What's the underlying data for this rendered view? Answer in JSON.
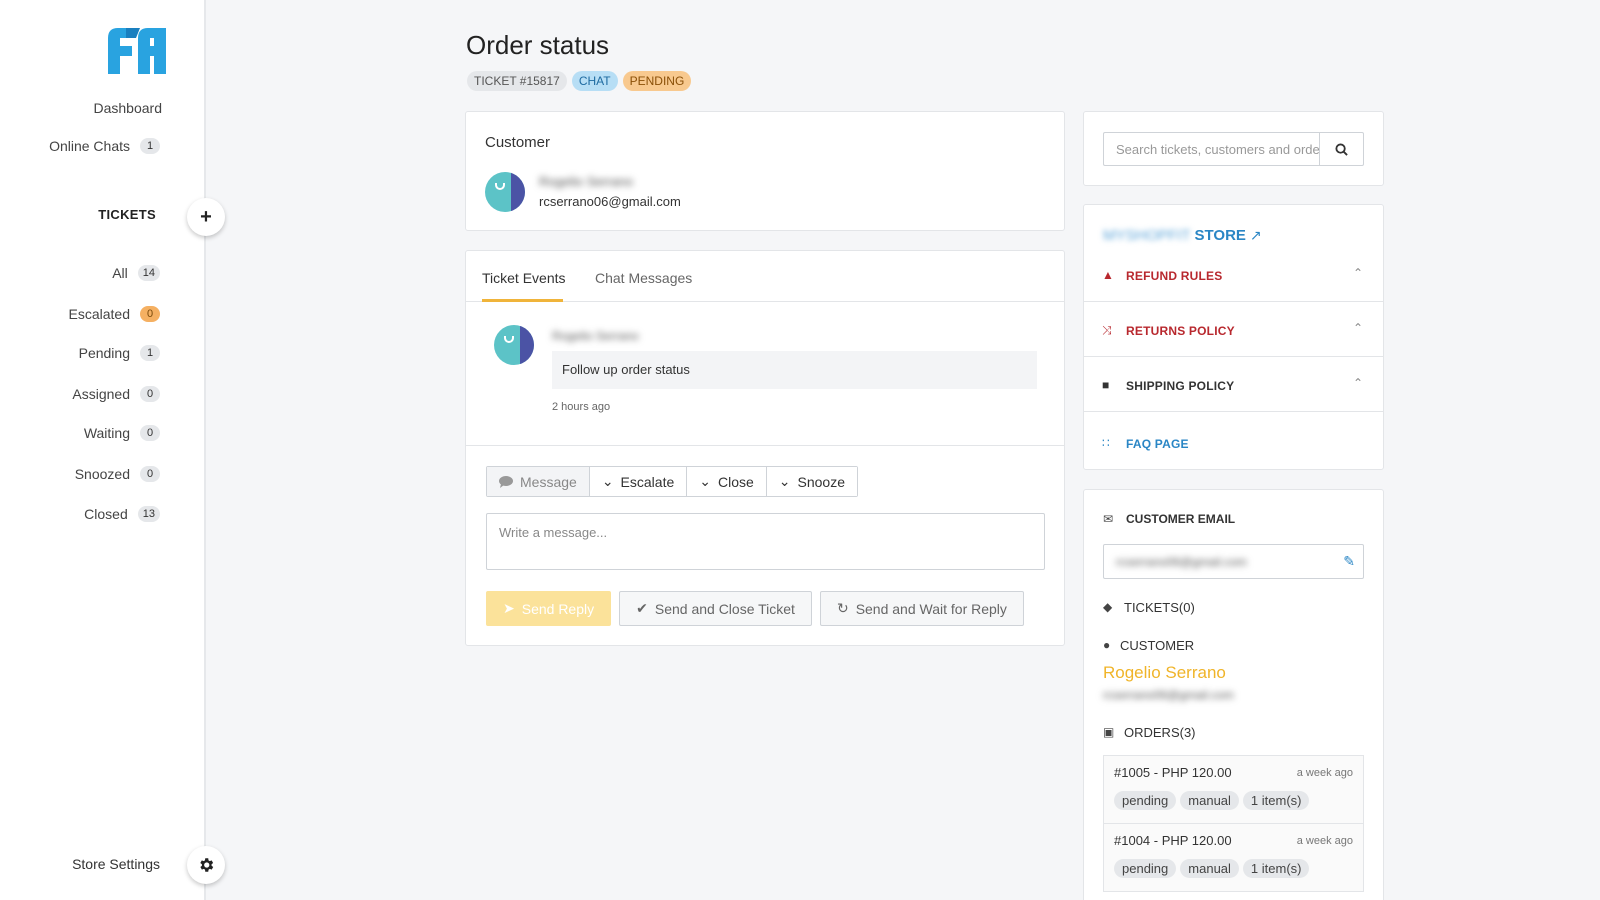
{
  "sidebar": {
    "dashboard": "Dashboard",
    "online_chats": {
      "label": "Online Chats",
      "count": "1"
    },
    "tickets_header": "TICKETS",
    "add_icon": "plus-icon",
    "items": [
      {
        "label": "All",
        "count": "14"
      },
      {
        "label": "Escalated",
        "count": "0"
      },
      {
        "label": "Pending",
        "count": "1"
      },
      {
        "label": "Assigned",
        "count": "0"
      },
      {
        "label": "Waiting",
        "count": "0"
      },
      {
        "label": "Snoozed",
        "count": "0"
      },
      {
        "label": "Closed",
        "count": "13"
      }
    ],
    "store_settings": "Store Settings",
    "settings_icon": "gear-icon"
  },
  "page": {
    "title": "Order status",
    "tags": {
      "ticket": "TICKET #15817",
      "channel": "CHAT",
      "status": "PENDING"
    }
  },
  "customer_card": {
    "header": "Customer",
    "name": "Rogelio Serrano",
    "email": "rcserrano06@gmail.com"
  },
  "events": {
    "tabs": [
      "Ticket Events",
      "Chat Messages"
    ],
    "event": {
      "author": "Rogelio Serrano",
      "message": "Follow up order status",
      "time": "2 hours ago"
    },
    "actions": {
      "message": "Message",
      "escalate": "Escalate",
      "close": "Close",
      "snooze": "Snooze"
    },
    "reply_placeholder": "Write a message...",
    "buttons": {
      "send_reply": "Send Reply",
      "send_close": "Send and Close Ticket",
      "send_wait": "Send and Wait for Reply"
    }
  },
  "search": {
    "placeholder": "Search tickets, customers and orders"
  },
  "store": {
    "name": "MYSHOPFIT",
    "label": "STORE",
    "policies": [
      "REFUND RULES",
      "RETURNS POLICY",
      "SHIPPING POLICY",
      "FAQ PAGE"
    ]
  },
  "info": {
    "customer_email_label": "CUSTOMER EMAIL",
    "email_value": "rcserrano06@gmail.com",
    "tickets_label": "TICKETS(0)",
    "customer_label": "CUSTOMER",
    "customer_name": "Rogelio Serrano",
    "customer_email": "rcserrano06@gmail.com",
    "orders_label": "ORDERS(3)",
    "orders": [
      {
        "title": "#1005 - PHP 120.00",
        "time": "a week ago",
        "tags": [
          "pending",
          "manual",
          "1 item(s)"
        ]
      },
      {
        "title": "#1004 - PHP 120.00",
        "time": "a week ago",
        "tags": [
          "pending",
          "manual",
          "1 item(s)"
        ]
      }
    ]
  },
  "colors": {
    "accent_yellow": "#f0b43a",
    "brand_blue": "#2a86c5",
    "danger_red": "#b8282e"
  }
}
